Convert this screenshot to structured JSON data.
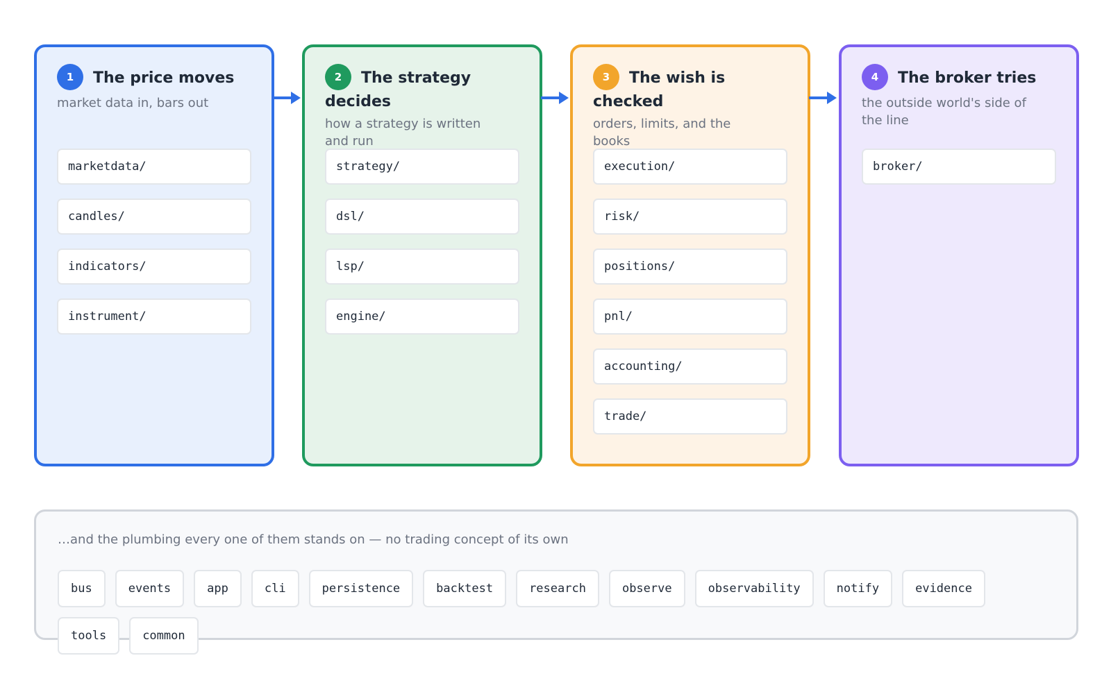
{
  "lanes": [
    {
      "number": "1",
      "title": "The price moves",
      "subtitle": "market data in, bars out",
      "color": "#2f6fe6",
      "packages": [
        "marketdata/",
        "candles/",
        "indicators/",
        "instrument/"
      ]
    },
    {
      "number": "2",
      "title": "The strategy decides",
      "subtitle": "how a strategy is written and run",
      "color": "#1f9a5e",
      "packages": [
        "strategy/",
        "dsl/",
        "lsp/",
        "engine/"
      ]
    },
    {
      "number": "3",
      "title": "The wish is checked",
      "subtitle": "orders, limits, and the books",
      "color": "#f2a52b",
      "packages": [
        "execution/",
        "risk/",
        "positions/",
        "pnl/",
        "accounting/",
        "trade/"
      ]
    },
    {
      "number": "4",
      "title": "The broker tries",
      "subtitle": "the outside world's side of the line",
      "color": "#7c5ff0",
      "packages": [
        "broker/"
      ]
    }
  ],
  "plumbing": {
    "label": "…and the plumbing every one of them stands on — no trading concept of its own",
    "packages": [
      "bus",
      "events",
      "app",
      "cli",
      "persistence",
      "backtest",
      "research",
      "observe",
      "observability",
      "notify",
      "evidence",
      "tools",
      "common"
    ]
  },
  "colors": {
    "arrow": "#2f6fe6",
    "plumbing_border": "#d1d5db"
  }
}
